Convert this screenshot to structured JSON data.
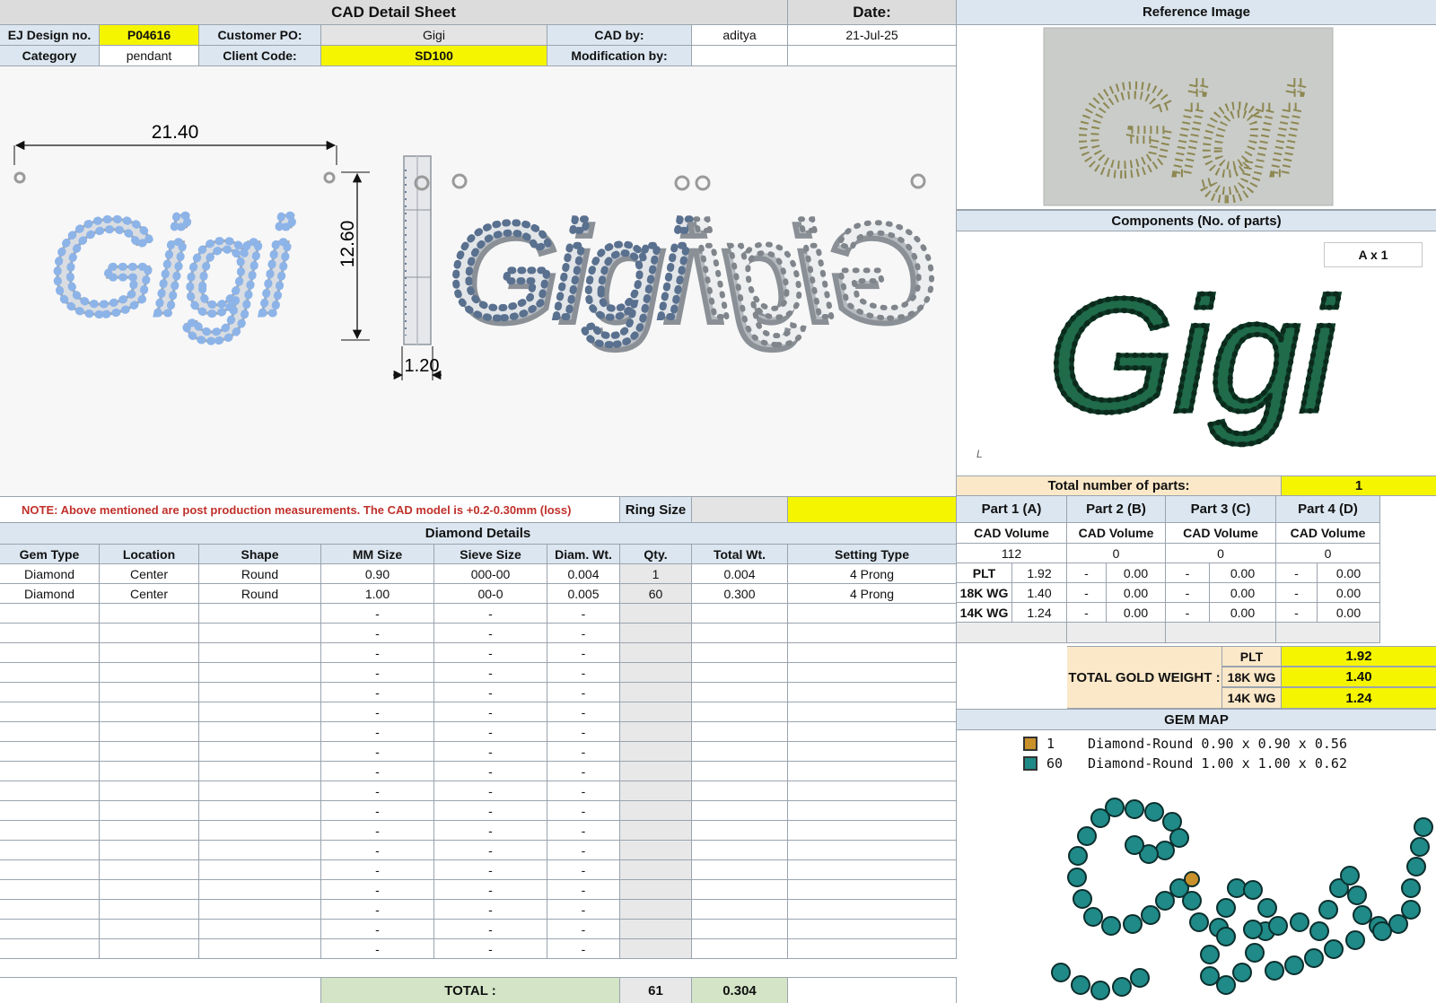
{
  "header": {
    "title": "CAD Detail Sheet",
    "date_label": "Date:",
    "date_value": "21-Jul-25",
    "design_no_label": "EJ Design no.",
    "design_no": "P04616",
    "customer_po_label": "Customer PO:",
    "customer_po": "Gigi",
    "cad_by_label": "CAD by:",
    "cad_by": "aditya",
    "category_label": "Category",
    "category": "pendant",
    "client_code_label": "Client Code:",
    "client_code": "SD100",
    "modification_label": "Modification by:",
    "modification_by": ""
  },
  "drawing": {
    "width_dim": "21.40",
    "height_dim": "12.60",
    "thickness_dim": "1.20",
    "script_text": "Gigi"
  },
  "note": {
    "text": "NOTE: Above mentioned are post production measurements. The CAD model is +0.2-0.30mm (loss)",
    "ring_size_label": "Ring Size",
    "ring_size": ""
  },
  "diamond_details": {
    "title": "Diamond Details",
    "columns": [
      "Gem Type",
      "Location",
      "Shape",
      "MM Size",
      "Sieve Size",
      "Diam. Wt.",
      "Qty.",
      "Total Wt.",
      "Setting Type"
    ],
    "rows": [
      [
        "Diamond",
        "Center",
        "Round",
        "0.90",
        "000-00",
        "0.004",
        "1",
        "0.004",
        "4 Prong"
      ],
      [
        "Diamond",
        "Center",
        "Round",
        "1.00",
        "00-0",
        "0.005",
        "60",
        "0.300",
        "4 Prong"
      ],
      [
        "",
        "",
        "",
        "-",
        "-",
        "-",
        "",
        "",
        ""
      ],
      [
        "",
        "",
        "",
        "-",
        "-",
        "-",
        "",
        "",
        ""
      ],
      [
        "",
        "",
        "",
        "-",
        "-",
        "-",
        "",
        "",
        ""
      ],
      [
        "",
        "",
        "",
        "-",
        "-",
        "-",
        "",
        "",
        ""
      ],
      [
        "",
        "",
        "",
        "-",
        "-",
        "-",
        "",
        "",
        ""
      ],
      [
        "",
        "",
        "",
        "-",
        "-",
        "-",
        "",
        "",
        ""
      ],
      [
        "",
        "",
        "",
        "-",
        "-",
        "-",
        "",
        "",
        ""
      ],
      [
        "",
        "",
        "",
        "-",
        "-",
        "-",
        "",
        "",
        ""
      ],
      [
        "",
        "",
        "",
        "-",
        "-",
        "-",
        "",
        "",
        ""
      ],
      [
        "",
        "",
        "",
        "-",
        "-",
        "-",
        "",
        "",
        ""
      ],
      [
        "",
        "",
        "",
        "-",
        "-",
        "-",
        "",
        "",
        ""
      ],
      [
        "",
        "",
        "",
        "-",
        "-",
        "-",
        "",
        "",
        ""
      ],
      [
        "",
        "",
        "",
        "-",
        "-",
        "-",
        "",
        "",
        ""
      ],
      [
        "",
        "",
        "",
        "-",
        "-",
        "-",
        "",
        "",
        ""
      ],
      [
        "",
        "",
        "",
        "-",
        "-",
        "-",
        "",
        "",
        ""
      ],
      [
        "",
        "",
        "",
        "-",
        "-",
        "-",
        "",
        "",
        ""
      ],
      [
        "",
        "",
        "",
        "-",
        "-",
        "-",
        "",
        "",
        ""
      ],
      [
        "",
        "",
        "",
        "-",
        "-",
        "-",
        "",
        "",
        ""
      ]
    ],
    "total_label": "TOTAL :",
    "total_qty": "61",
    "total_wt": "0.304"
  },
  "reference": {
    "title": "Reference Image",
    "photo_text": "Gigi"
  },
  "components": {
    "title": "Components (No. of parts)",
    "qty_badge": "A x 1",
    "render_text": "Gigi",
    "corner_mark": "L"
  },
  "parts": {
    "total_label": "Total number of parts:",
    "total_value": "1",
    "headers": [
      "Part 1 (A)",
      "Part 2 (B)",
      "Part 3 (C)",
      "Part 4 (D)"
    ],
    "volume_label": "CAD Volume",
    "volumes": [
      "112",
      "0",
      "0",
      "0"
    ],
    "metals": [
      {
        "name": "PLT",
        "values": [
          "1.92",
          "0.00",
          "0.00",
          "0.00"
        ]
      },
      {
        "name": "18K WG",
        "values": [
          "1.40",
          "0.00",
          "0.00",
          "0.00"
        ]
      },
      {
        "name": "14K WG",
        "values": [
          "1.24",
          "0.00",
          "0.00",
          "0.00"
        ]
      }
    ],
    "dash": "-"
  },
  "gold_weight": {
    "label": "TOTAL GOLD WEIGHT :",
    "rows": [
      {
        "metal": "PLT",
        "value": "1.92"
      },
      {
        "metal": "18K WG",
        "value": "1.40"
      },
      {
        "metal": "14K WG",
        "value": "1.24"
      }
    ]
  },
  "gem_map": {
    "title": "GEM MAP",
    "legend": [
      {
        "count": "1",
        "desc": "Diamond-Round 0.90 x 0.90 x 0.56",
        "color": "#c8912a"
      },
      {
        "count": "60",
        "desc": "Diamond-Round 1.00 x 1.00 x 0.62",
        "color": "#1f8a87"
      }
    ]
  },
  "colors": {
    "header_blue": "#dbe6f0",
    "highlight_yellow": "#f5f500",
    "note_red": "#c0302b",
    "gem_teal": "#1f8a87",
    "render_green": "#1f6b4a",
    "stone_blue": "#8db4e8"
  }
}
